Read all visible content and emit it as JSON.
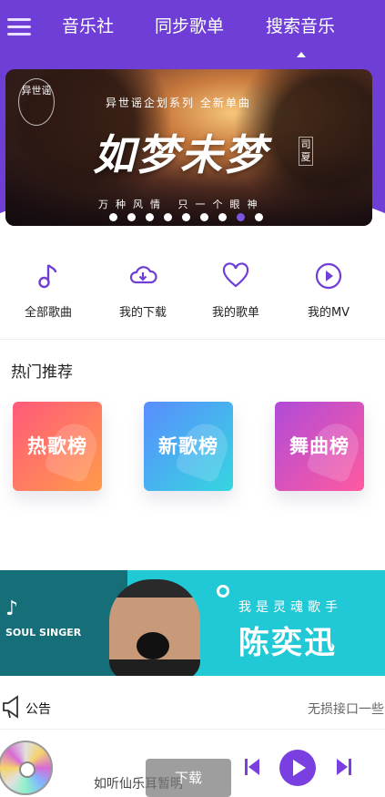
{
  "header": {
    "tabs": [
      {
        "label": "音乐社"
      },
      {
        "label": "同步歌单"
      },
      {
        "label": "搜索音乐"
      }
    ],
    "active_tab_index": 2,
    "accent_color": "#6f3ed6"
  },
  "banner": {
    "logo": "异世谣",
    "subtitle": "异世谣企划系列 全新单曲",
    "title": "如梦未梦",
    "artist": "司夏",
    "caption": "万种风情 只一个眼神",
    "dot_count": 9,
    "active_dot_index": 7
  },
  "quick_entries": [
    {
      "label": "全部歌曲",
      "icon": "music-note-icon"
    },
    {
      "label": "我的下载",
      "icon": "cloud-download-icon"
    },
    {
      "label": "我的歌单",
      "icon": "heart-icon"
    },
    {
      "label": "我的MV",
      "icon": "play-circle-icon"
    }
  ],
  "hot": {
    "title": "热门推荐",
    "charts": [
      {
        "label": "热歌榜"
      },
      {
        "label": "新歌榜"
      },
      {
        "label": "舞曲榜"
      }
    ]
  },
  "ad": {
    "singer_en": "SOUL SINGER",
    "slogan": "我是灵魂歌手",
    "name": "陈奕迅"
  },
  "notice": {
    "title": "公告",
    "text": "无损接口一些"
  },
  "player": {
    "song": "如听仙乐耳暂明",
    "toast": "下载",
    "play_color": "#7a3fe0"
  }
}
